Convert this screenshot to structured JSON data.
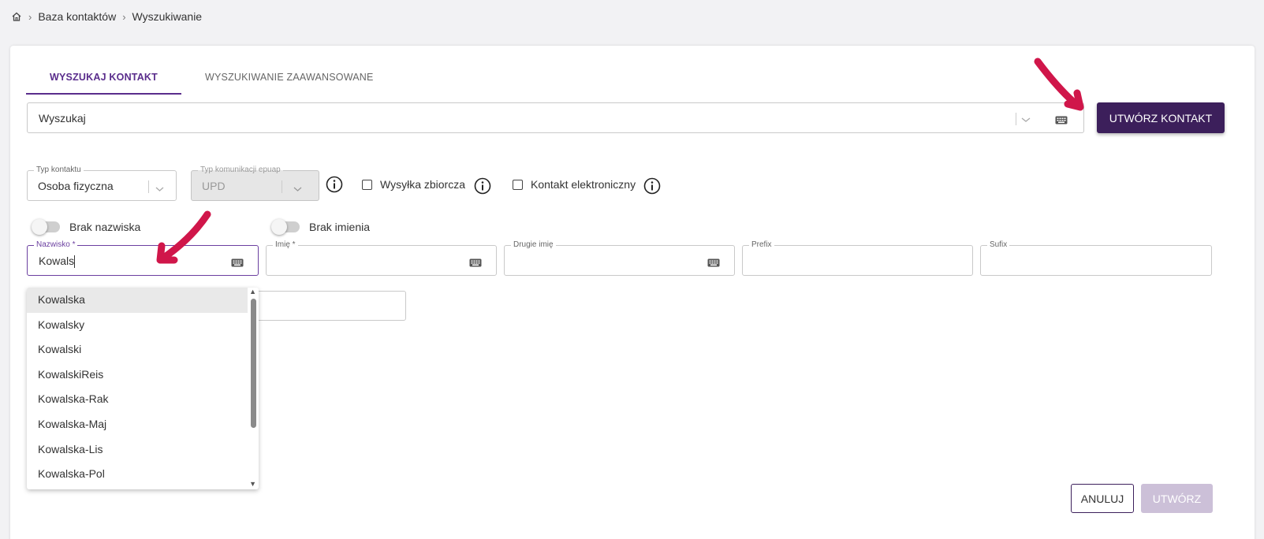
{
  "breadcrumb": {
    "items": [
      "Baza kontaktów",
      "Wyszukiwanie"
    ]
  },
  "tabs": [
    {
      "label": "WYSZUKAJ KONTAKT",
      "active": true
    },
    {
      "label": "WYSZUKIWANIE ZAAWANSOWANE",
      "active": false
    }
  ],
  "search": {
    "placeholder": "Wyszukaj"
  },
  "create_contact_label": "UTWÓRZ KONTAKT",
  "contact_type": {
    "label": "Typ kontaktu",
    "value": "Osoba fizyczna"
  },
  "epuap_type": {
    "label": "Typ komunikacji epuap",
    "value": "UPD"
  },
  "checkboxes": {
    "bulk": "Wysyłka zbiorcza",
    "electronic": "Kontakt elektroniczny"
  },
  "toggles": {
    "no_surname": "Brak nazwiska",
    "no_firstname": "Brak imienia"
  },
  "fields": {
    "surname": {
      "label": "Nazwisko *",
      "value": "Kowals"
    },
    "firstname": {
      "label": "Imię *"
    },
    "second_name": {
      "label": "Drugie imię"
    },
    "prefix": {
      "label": "Prefix"
    },
    "suffix": {
      "label": "Sufix"
    }
  },
  "suggestions": [
    "Kowalska",
    "Kowalsky",
    "Kowalski",
    "KowalskiReis",
    "Kowalska-Rak",
    "Kowalska-Maj",
    "Kowalska-Lis",
    "Kowalska-Pol"
  ],
  "buttons": {
    "cancel": "ANULUJ",
    "create": "UTWÓRZ"
  },
  "colors": {
    "accent": "#5a2d8c",
    "primary_button": "#3c1f5b",
    "annotation_arrow": "#d0164a"
  }
}
